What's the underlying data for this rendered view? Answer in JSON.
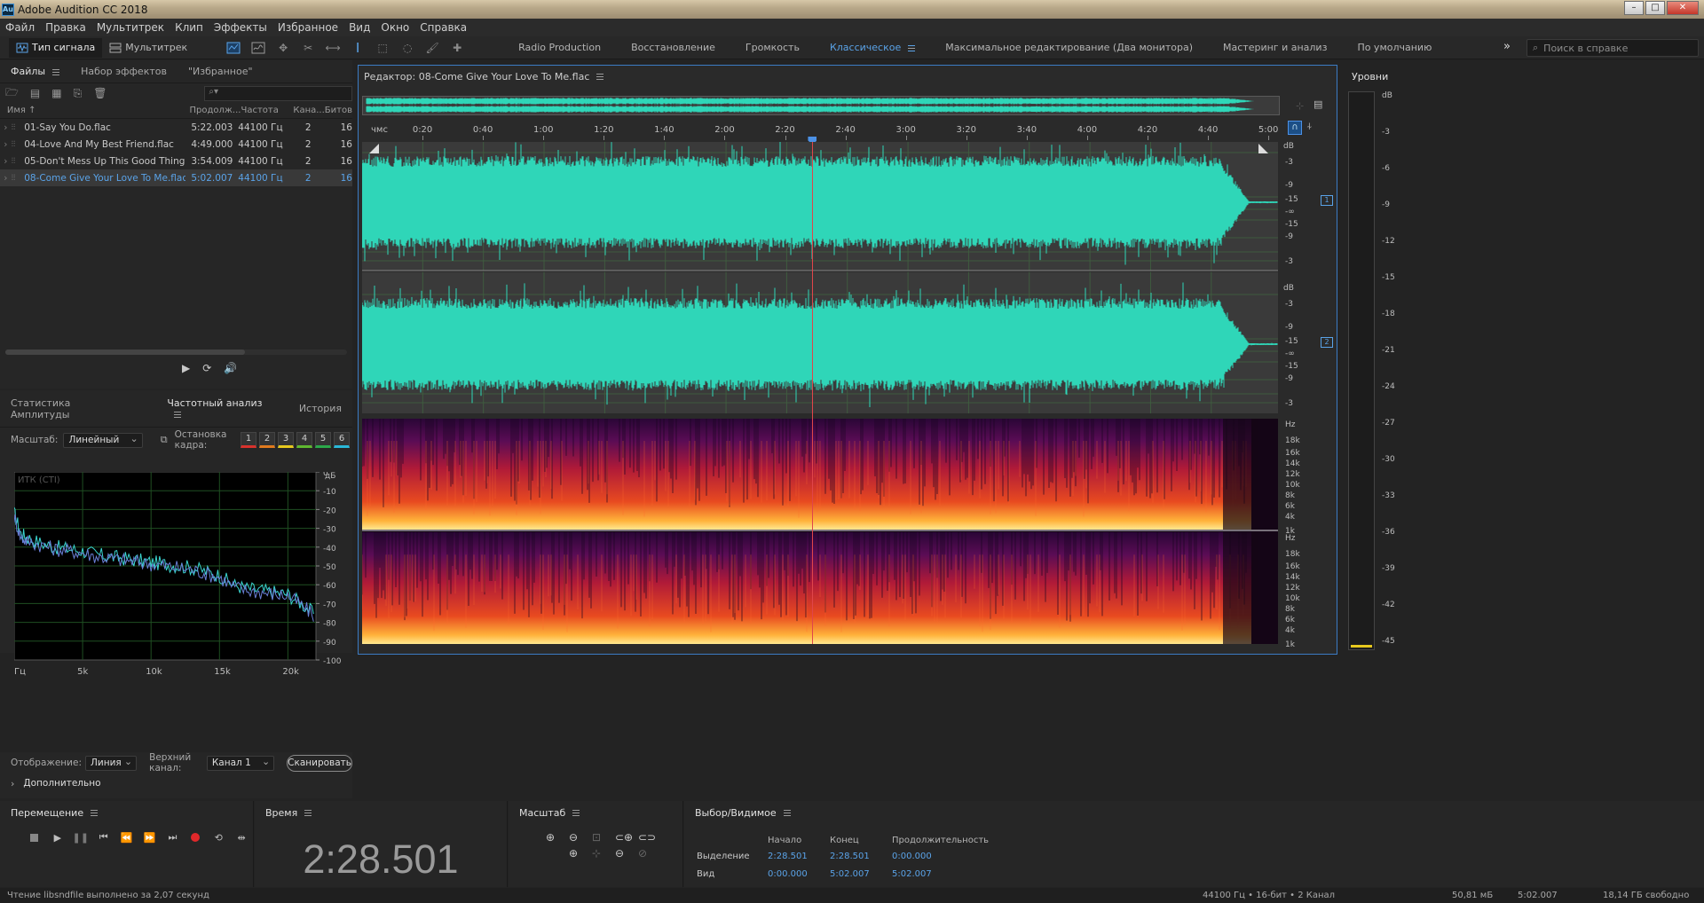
{
  "app": {
    "title": "Adobe Audition CC 2018",
    "icon_text": "Au"
  },
  "menu": [
    "Файл",
    "Правка",
    "Мультитрек",
    "Клип",
    "Эффекты",
    "Избранное",
    "Вид",
    "Окно",
    "Справка"
  ],
  "toolbar": {
    "view_tabs": [
      "Тип сигнала",
      "Мультитрек"
    ],
    "workspaces": [
      "Radio Production",
      "Восстановление",
      "Громкость",
      "Классическое",
      "Максимальное редактирование (Два монитора)",
      "Мастеринг и анализ",
      "По умолчанию"
    ],
    "active_workspace": "Классическое",
    "search_placeholder": "Поиск в справке"
  },
  "files_panel": {
    "tabs": [
      "Файлы",
      "Набор эффектов",
      "\"Избранное\""
    ],
    "columns": [
      "Имя ↑",
      "Продолж...",
      "Частота",
      "Кана...",
      "Битов"
    ],
    "rows": [
      {
        "name": "01-Say You Do.flac",
        "duration": "5:22.003",
        "rate": "44100 Гц",
        "channels": "2",
        "bits": "16"
      },
      {
        "name": "04-Love And My Best Friend.flac",
        "duration": "4:49.000",
        "rate": "44100 Гц",
        "channels": "2",
        "bits": "16"
      },
      {
        "name": "05-Don't Mess Up This Good Thing.flac",
        "duration": "3:54.009",
        "rate": "44100 Гц",
        "channels": "2",
        "bits": "16"
      },
      {
        "name": "08-Come Give Your Love To Me.flac",
        "duration": "5:02.007",
        "rate": "44100 Гц",
        "channels": "2",
        "bits": "16"
      }
    ],
    "selected_index": 3
  },
  "analysis_panel": {
    "tabs": [
      "Статистика Амплитуды",
      "Частотный анализ",
      "История"
    ],
    "scale_label": "Масштаб:",
    "scale_value": "Линейный",
    "frame_label": "Остановка кадра:",
    "frame_buttons": [
      "1",
      "2",
      "3",
      "4",
      "5",
      "6"
    ],
    "frame_colors": [
      "#d8322c",
      "#e07a1e",
      "#e6c81e",
      "#5fb830",
      "#2ba84a",
      "#2ab8d8"
    ],
    "display_label": "Отображение:",
    "display_value": "Линия",
    "channel_label": "Верхний канал:",
    "channel_value": "Канал 1",
    "scan_button": "Сканировать",
    "more_label": "Дополнительно"
  },
  "chart_data": {
    "type": "line",
    "title": "ИТК (СТI)",
    "xlabel": "Гц",
    "ylabel": "дБ",
    "x_ticks": [
      "Гц",
      "5k",
      "10k",
      "15k",
      "20k"
    ],
    "y_ticks": [
      "0",
      "-10",
      "-20",
      "-30",
      "-40",
      "-50",
      "-60",
      "-70",
      "-80",
      "-90",
      "-100"
    ],
    "xlim": [
      0,
      22050
    ],
    "ylim": [
      -100,
      0
    ],
    "grid": true,
    "series": [
      {
        "color": "#3ad6d0",
        "x": [
          0,
          500,
          1000,
          2000,
          3000,
          4000,
          5000,
          6000,
          7000,
          8000,
          9000,
          10000,
          11000,
          12000,
          13000,
          14000,
          15000,
          16000,
          17000,
          18000,
          19000,
          20000,
          21000,
          22000
        ],
        "values": [
          -22,
          -33,
          -35,
          -38,
          -40,
          -41,
          -42,
          -44,
          -45,
          -46,
          -47,
          -48,
          -49,
          -50,
          -51,
          -53,
          -55,
          -60,
          -62,
          -63,
          -64,
          -65,
          -70,
          -76
        ]
      },
      {
        "color": "#6a7fd6",
        "x": [
          0,
          500,
          1000,
          2000,
          3000,
          4000,
          5000,
          6000,
          7000,
          8000,
          9000,
          10000,
          11000,
          12000,
          13000,
          14000,
          15000,
          16000,
          17000,
          18000,
          19000,
          20000,
          21000,
          22000
        ],
        "values": [
          -24,
          -35,
          -37,
          -39,
          -41,
          -42,
          -43,
          -45,
          -46,
          -47,
          -48,
          -49,
          -50,
          -51,
          -52,
          -54,
          -56,
          -61,
          -63,
          -64,
          -65,
          -66,
          -71,
          -77
        ]
      }
    ]
  },
  "editor": {
    "title": "Редактор: 08-Come Give Your Love To Me.flac",
    "ruler_unit": "чмс",
    "ruler_labels": [
      "0:20",
      "0:40",
      "1:00",
      "1:20",
      "1:40",
      "2:00",
      "2:20",
      "2:40",
      "3:00",
      "3:20",
      "3:40",
      "4:00",
      "4:20",
      "4:40",
      "5:00"
    ],
    "duration_seconds": 302.007,
    "playhead_seconds": 148.501,
    "db_scale_ch": [
      "dB",
      "-3",
      "-9",
      "-15",
      "-∞",
      "-15",
      "-9",
      "-3"
    ],
    "channels": [
      "1",
      "2"
    ],
    "hz_scale": [
      "Hz",
      "18k",
      "16k",
      "14k",
      "12k",
      "10k",
      "8k",
      "6k",
      "4k",
      "1k"
    ]
  },
  "meter": {
    "title": "Уровни",
    "scale": [
      "dB",
      "-3",
      "-6",
      "-9",
      "-12",
      "-15",
      "-18",
      "-21",
      "-24",
      "-27",
      "-30",
      "-33",
      "-36",
      "-39",
      "-42",
      "-45"
    ]
  },
  "transport": {
    "title": "Перемещение"
  },
  "time": {
    "title": "Время",
    "value": "2:28.501"
  },
  "zoom": {
    "title": "Масштаб"
  },
  "selection": {
    "title": "Выбор/Видимое",
    "headers": [
      "Начало",
      "Конец",
      "Продолжительность"
    ],
    "rows": [
      {
        "label": "Выделение",
        "start": "2:28.501",
        "end": "2:28.501",
        "duration": "0:00.000"
      },
      {
        "label": "Вид",
        "start": "0:00.000",
        "end": "5:02.007",
        "duration": "5:02.007"
      }
    ]
  },
  "status": {
    "message": "Чтение libsndfile выполнено за 2,07 секунд",
    "format": "44100 Гц • 16-бит • 2 Канал",
    "size": "50,81 мБ",
    "duration": "5:02.007",
    "free": "18,14 ГБ свободно"
  },
  "colors": {
    "accent": "#5aa3e8",
    "waveform": "#2fd6b8",
    "playhead": "#e0454a"
  }
}
